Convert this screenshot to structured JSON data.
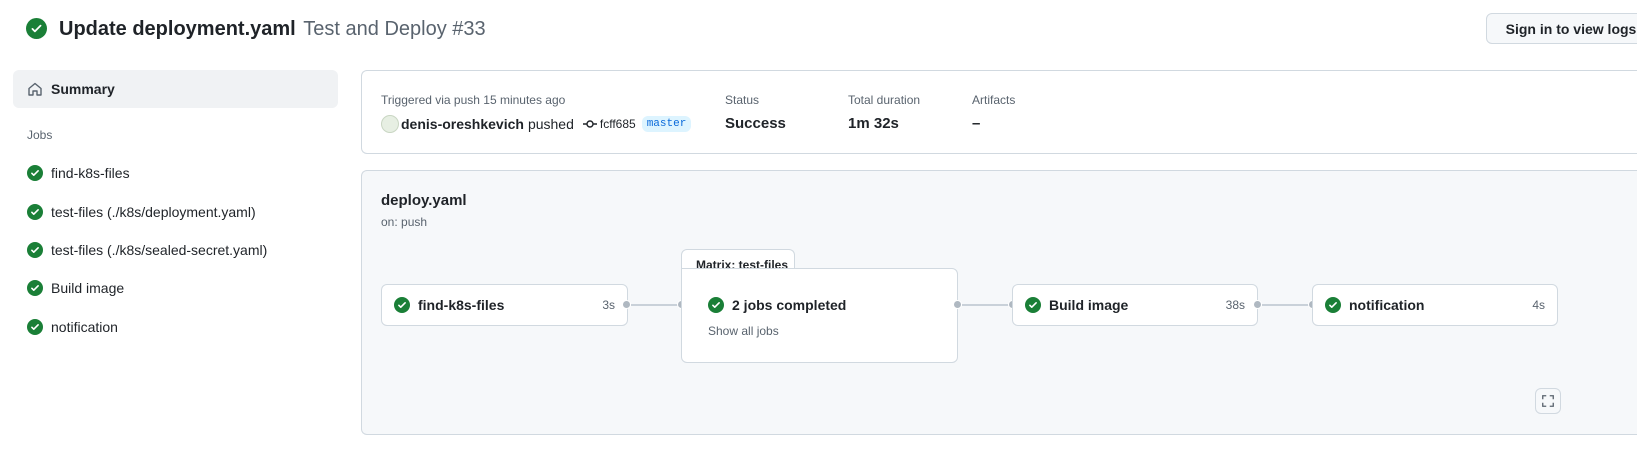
{
  "header": {
    "commit_message": "Update deployment.yaml",
    "workflow_run": "Test and Deploy #33",
    "signin_label": "Sign in to view logs"
  },
  "sidebar": {
    "summary_label": "Summary",
    "jobs_heading": "Jobs",
    "jobs": [
      {
        "label": "find-k8s-files",
        "status": "success"
      },
      {
        "label": "test-files (./k8s/deployment.yaml)",
        "status": "success"
      },
      {
        "label": "test-files (./k8s/sealed-secret.yaml)",
        "status": "success"
      },
      {
        "label": "Build image",
        "status": "success"
      },
      {
        "label": "notification",
        "status": "success"
      }
    ]
  },
  "summary": {
    "trigger_text": "Triggered via push 15 minutes ago",
    "actor": "denis-oreshkevich",
    "action": "pushed",
    "commit_sha": "fcff685",
    "branch": "master",
    "status_label": "Status",
    "status_value": "Success",
    "duration_label": "Total duration",
    "duration_value": "1m 32s",
    "artifacts_label": "Artifacts",
    "artifacts_value": "–"
  },
  "graph": {
    "workflow_file": "deploy.yaml",
    "trigger": "on: push",
    "jobs": [
      {
        "name": "find-k8s-files",
        "duration": "3s"
      },
      {
        "name": "Build image",
        "duration": "38s"
      },
      {
        "name": "notification",
        "duration": "4s"
      }
    ],
    "matrix": {
      "tab_label": "Matrix: test-files",
      "summary": "2 jobs completed",
      "show_all": "Show all jobs"
    }
  },
  "colors": {
    "success": "#1a7f37",
    "accent": "#0969da",
    "muted": "#59636e"
  }
}
